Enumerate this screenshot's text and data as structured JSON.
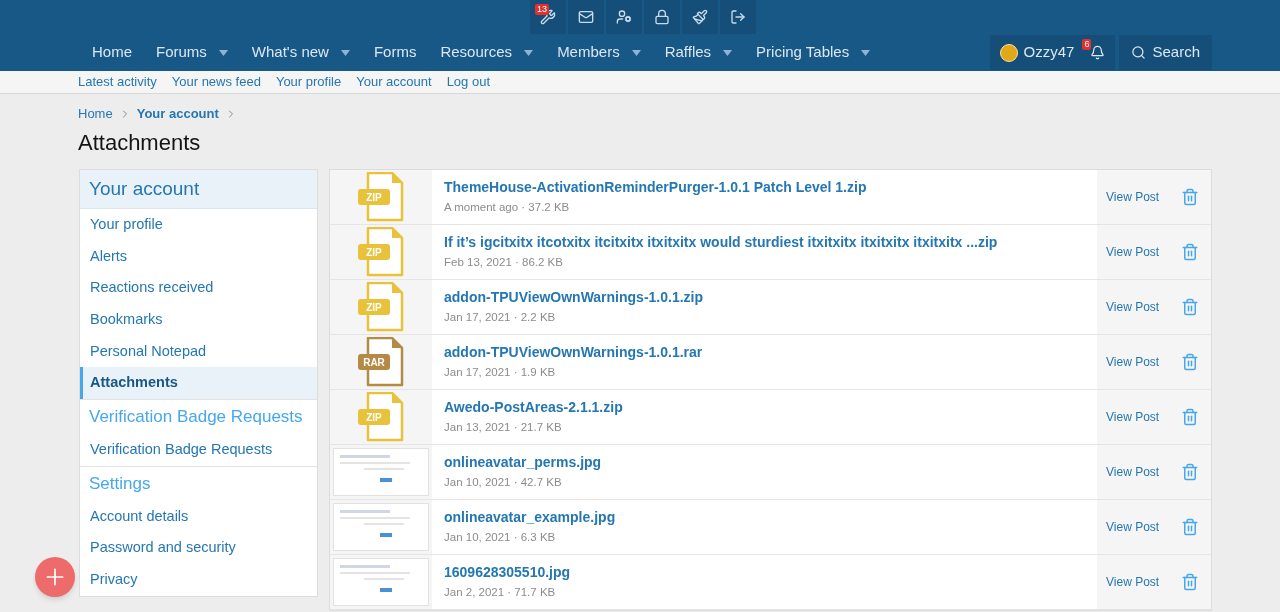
{
  "toolbar": [
    {
      "kind": "tools",
      "badge": "13"
    },
    {
      "kind": "mail"
    },
    {
      "kind": "users"
    },
    {
      "kind": "lock"
    },
    {
      "kind": "brush"
    },
    {
      "kind": "logout"
    }
  ],
  "nav": [
    {
      "label": "Home",
      "has_menu": false
    },
    {
      "label": "Forums",
      "has_menu": true
    },
    {
      "label": "What's new",
      "has_menu": true
    },
    {
      "label": "Forms",
      "has_menu": false
    },
    {
      "label": "Resources",
      "has_menu": true
    },
    {
      "label": "Members",
      "has_menu": true
    },
    {
      "label": "Raffles",
      "has_menu": true
    },
    {
      "label": "Pricing Tables",
      "has_menu": true
    }
  ],
  "user": {
    "name": "Ozzy47",
    "alerts_badge": "6"
  },
  "search": {
    "label": "Search"
  },
  "subnav": [
    "Latest activity",
    "Your news feed",
    "Your profile",
    "Your account",
    "Log out"
  ],
  "breadcrumb": [
    {
      "label": "Home",
      "emphasized": false
    },
    {
      "label": "Your account",
      "emphasized": true
    }
  ],
  "title": "Attachments",
  "sidebar": [
    {
      "heading": "Your account",
      "highlighted": true,
      "items": [
        {
          "label": "Your profile",
          "selected": false
        },
        {
          "label": "Alerts",
          "selected": false
        },
        {
          "label": "Reactions received",
          "selected": false
        },
        {
          "label": "Bookmarks",
          "selected": false
        },
        {
          "label": "Personal Notepad",
          "selected": false
        },
        {
          "label": "Attachments",
          "selected": true
        }
      ]
    },
    {
      "heading": "Verification Badge Requests",
      "highlighted": false,
      "items": [
        {
          "label": "Verification Badge Requests",
          "selected": false
        }
      ]
    },
    {
      "heading": "Settings",
      "highlighted": false,
      "items": [
        {
          "label": "Account details",
          "selected": false
        },
        {
          "label": "Password and security",
          "selected": false
        },
        {
          "label": "Privacy",
          "selected": false
        }
      ]
    }
  ],
  "attachments": [
    {
      "kind": "archive",
      "badge": "ZIP",
      "color": "#e8c23a",
      "name": "ThemeHouse-ActivationReminderPurger-1.0.1 Patch Level 1.zip",
      "meta": "A moment ago · 37.2 KB",
      "action": "View Post"
    },
    {
      "kind": "archive",
      "badge": "ZIP",
      "color": "#e8c23a",
      "name": "If it’s igcitxitx itcotxitx itcitxitx itxitxitx would sturdiest itxitxitx itxitxitx itxitxitx ...zip",
      "meta": "Feb 13, 2021 · 86.2 KB",
      "action": "View Post"
    },
    {
      "kind": "archive",
      "badge": "ZIP",
      "color": "#e8c23a",
      "name": "addon-TPUViewOwnWarnings-1.0.1.zip",
      "meta": "Jan 17, 2021 · 2.2 KB",
      "action": "View Post"
    },
    {
      "kind": "archive",
      "badge": "RAR",
      "color": "#b58a45",
      "name": "addon-TPUViewOwnWarnings-1.0.1.rar",
      "meta": "Jan 17, 2021 · 1.9 KB",
      "action": "View Post"
    },
    {
      "kind": "archive",
      "badge": "ZIP",
      "color": "#e8c23a",
      "name": "Awedo-PostAreas-2.1.1.zip",
      "meta": "Jan 13, 2021 · 21.7 KB",
      "action": "View Post"
    },
    {
      "kind": "image",
      "name": "onlineavatar_perms.jpg",
      "meta": "Jan 10, 2021 · 42.7 KB",
      "action": "View Post"
    },
    {
      "kind": "image",
      "name": "onlineavatar_example.jpg",
      "meta": "Jan 10, 2021 · 6.3 KB",
      "action": "View Post"
    },
    {
      "kind": "image",
      "name": "1609628305510.jpg",
      "meta": "Jan 2, 2021 · 71.7 KB",
      "action": "View Post"
    }
  ]
}
